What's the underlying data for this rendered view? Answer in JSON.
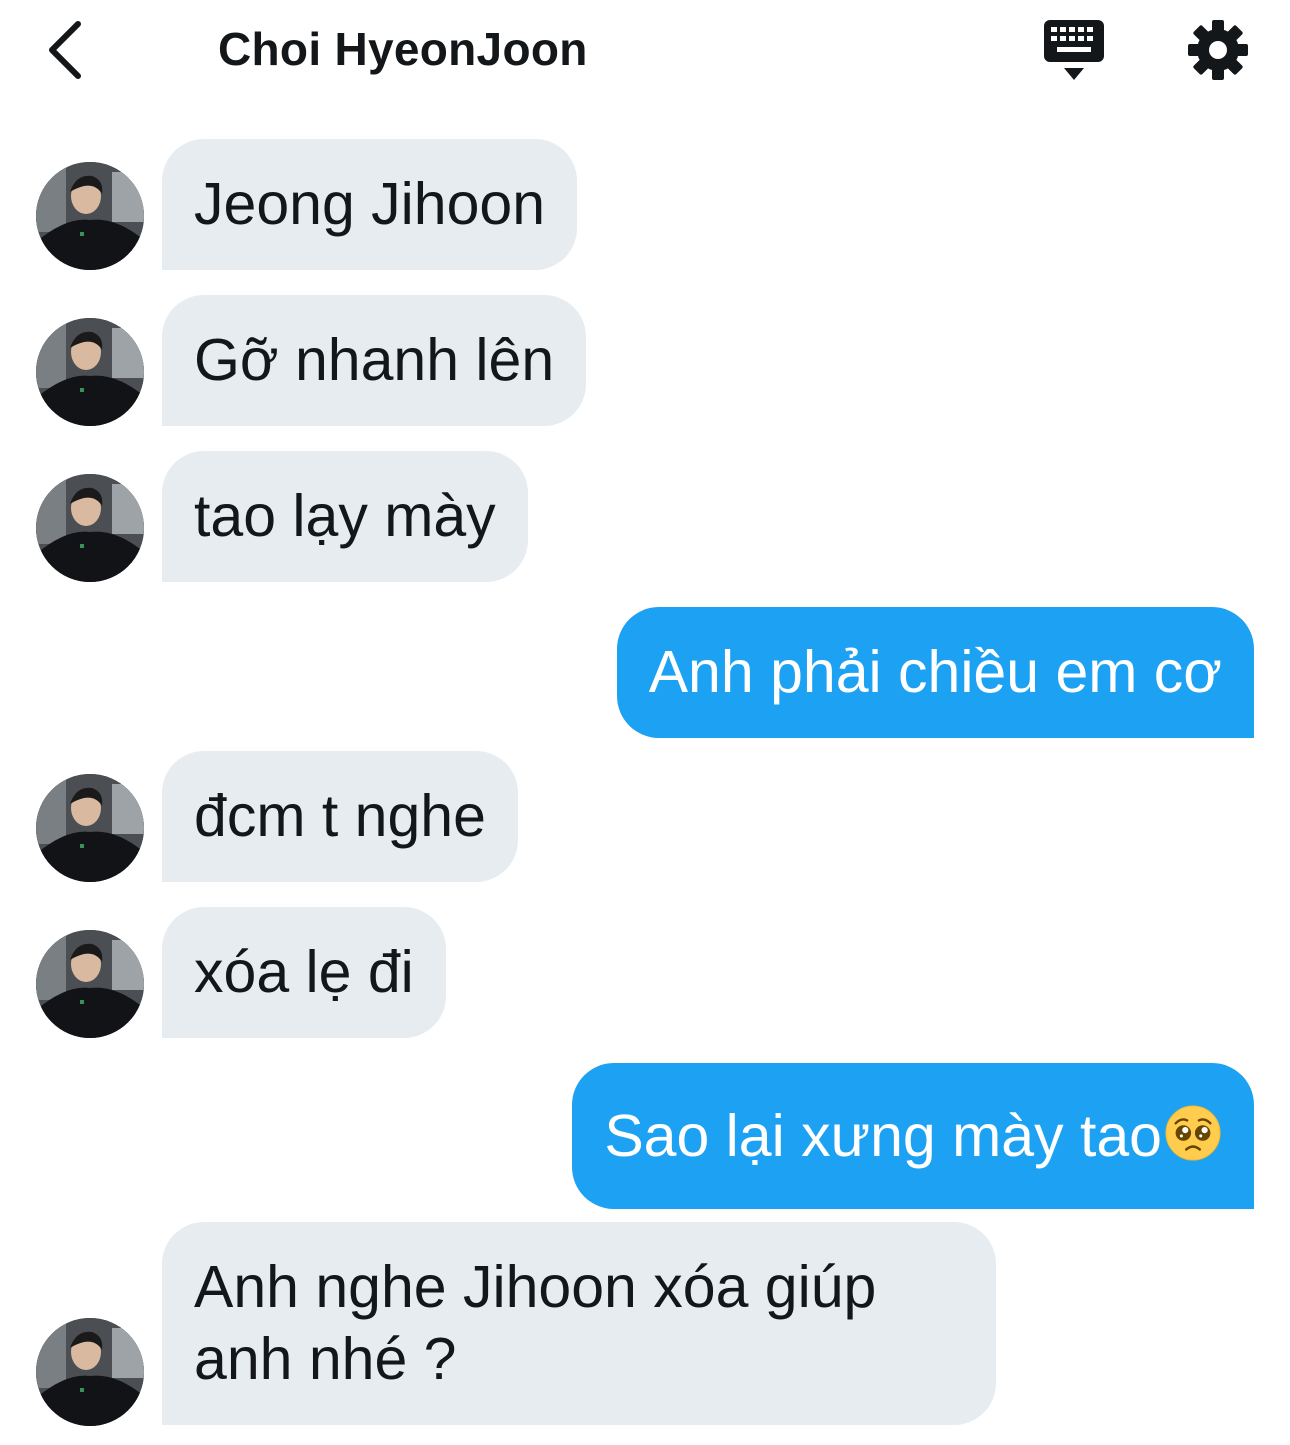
{
  "header": {
    "title": "Choi HyeonJoon",
    "back_icon": "chevron-left-icon",
    "keyboard_icon": "keyboard-icon",
    "settings_icon": "gear-icon"
  },
  "colors": {
    "incoming_bubble": "#e6ecf0",
    "outgoing_bubble": "#1da1f2",
    "text_dark": "#14171a",
    "text_light": "#ffffff"
  },
  "messages": [
    {
      "direction": "incoming",
      "text": "Jeong Jihoon"
    },
    {
      "direction": "incoming",
      "text": "Gỡ nhanh lên"
    },
    {
      "direction": "incoming",
      "text": "tao lạy mày"
    },
    {
      "direction": "outgoing",
      "text": "Anh phải chiều em cơ"
    },
    {
      "direction": "incoming",
      "text": "đcm t nghe"
    },
    {
      "direction": "incoming",
      "text": "xóa lẹ đi"
    },
    {
      "direction": "outgoing",
      "text": "Sao lại xưng mày tao",
      "emoji": "pleading-face-emoji"
    },
    {
      "direction": "incoming",
      "line1": "Anh nghe Jihoon xóa giúp",
      "line2": "anh nhé ?"
    }
  ]
}
